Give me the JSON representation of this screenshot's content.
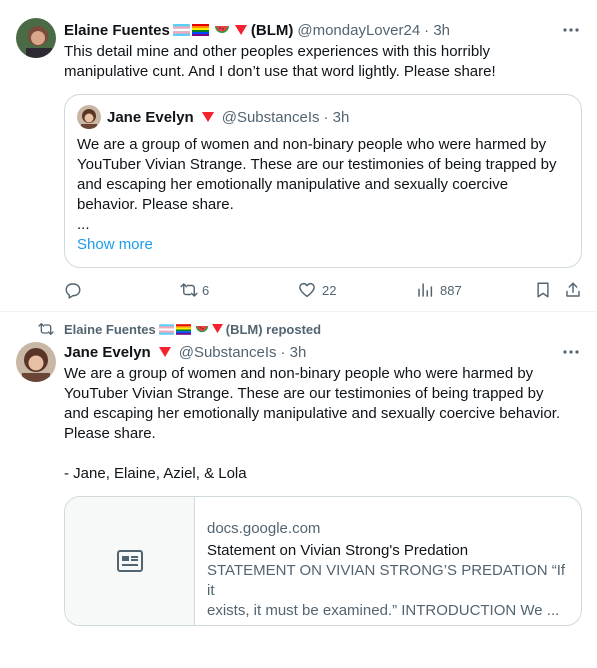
{
  "tweet1": {
    "author_name": "Elaine Fuentes",
    "author_suffix": "(BLM)",
    "handle": "@mondayLover24",
    "time": "· 3h",
    "text_lines": [
      "This detail mine and other peoples experiences with this horribly",
      "manipulative cunt. And I don’t use that word lightly. Please share!"
    ],
    "quote": {
      "author_name": "Jane Evelyn",
      "handle": "@SubstanceIs",
      "time": "· 3h",
      "text_lines": [
        "We are a group of women and non-binary people who were harmed by",
        "YouTuber Vivian Strange. These are our testimonies of being trapped by",
        "and escaping her emotionally manipulative and sexually coercive",
        "behavior. Please share."
      ],
      "ellipsis": "...",
      "show_more": "Show more"
    },
    "actions": {
      "reposts": "6",
      "likes": "22",
      "views": "887"
    }
  },
  "tweet2": {
    "reposted_by_name": "Elaine Fuentes",
    "reposted_by_suffix": "(BLM) reposted",
    "author_name": "Jane Evelyn",
    "handle": "@SubstanceIs",
    "time": "· 3h",
    "text_lines": [
      "We are a group of women and non-binary people who were harmed by",
      "YouTuber Vivian Strange. These are our testimonies of being trapped by",
      "and escaping her emotionally manipulative and sexually coercive behavior.",
      "Please share.",
      "",
      "- Jane, Elaine, Aziel, & Lola"
    ],
    "card": {
      "domain": "docs.google.com",
      "title": "Statement on Vivian Strong's Predation",
      "desc_lines": [
        "STATEMENT ON VIVIAN STRONG’S PREDATION “If it",
        "exists, it must be examined.” INTRODUCTION We ..."
      ]
    }
  },
  "icons": {
    "more": "more-dots-icon",
    "reply": "reply-icon",
    "repost": "repost-icon",
    "like": "heart-icon",
    "views": "views-chart-icon",
    "bookmark": "bookmark-icon",
    "share": "share-icon",
    "card_thumb": "document-icon",
    "flags": [
      "transgender-flag-icon",
      "rainbow-flag-icon",
      "watermelon-icon",
      "red-triangle-icon"
    ]
  },
  "colors": {
    "text": "#0f1419",
    "secondary": "#536471",
    "link": "#1d9bf0",
    "border": "#cfd9de",
    "triangle": "#f4212e"
  }
}
